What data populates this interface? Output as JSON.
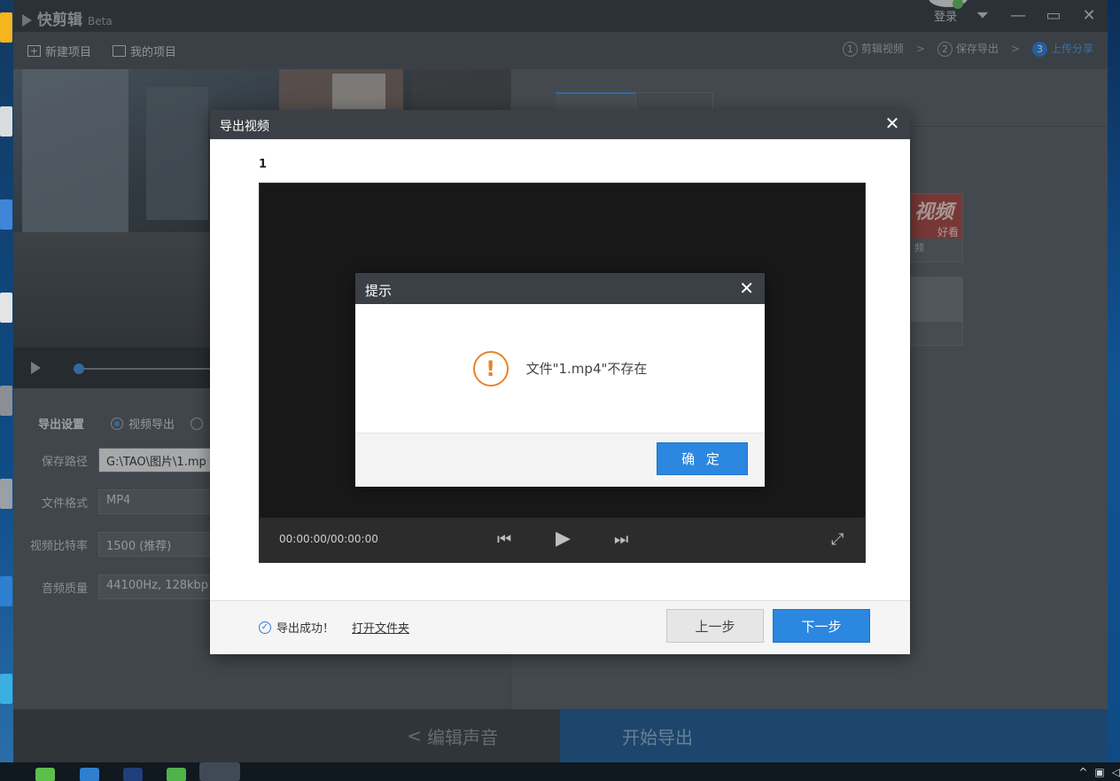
{
  "app": {
    "name": "快剪辑",
    "badge": "Beta",
    "login": "登录"
  },
  "toolbar": {
    "new_project": "新建项目",
    "my_projects": "我的项目"
  },
  "steps": [
    {
      "num": "1",
      "label": "剪辑视频"
    },
    {
      "num": "2",
      "label": "保存导出"
    },
    {
      "num": "3",
      "label": "上传分享"
    }
  ],
  "settings": {
    "title": "导出设置",
    "radio_video": "视频导出",
    "save_path_label": "保存路径",
    "save_path_value": "G:\\TAO\\图片\\1.mp",
    "format_label": "文件格式",
    "format_value": "MP4",
    "bitrate_label": "视频比特率",
    "bitrate_value": "1500 (推荐)",
    "audio_label": "音频质量",
    "audio_value": "44100Hz, 128kbp"
  },
  "right_panel": {
    "thumb_red_text": "视频",
    "thumb_red_sub": "好看",
    "thumb_red_cap": "频"
  },
  "bottom": {
    "back": "编辑声音",
    "start_export": "开始导出"
  },
  "export_dialog": {
    "title": "导出视频",
    "file_number": "1",
    "player_time": "00:00:00/00:00:00",
    "success_text": "导出成功！",
    "open_folder": "打开文件夹",
    "prev": "上一步",
    "next": "下一步"
  },
  "alert": {
    "title": "提示",
    "message": "文件\"1.mp4\"不存在",
    "ok": "确 定"
  },
  "colors": {
    "accent": "#2b87e0",
    "warning": "#e8832a",
    "header": "#3b4046"
  }
}
